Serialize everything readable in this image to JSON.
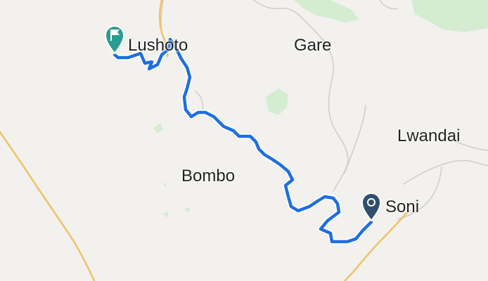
{
  "map": {
    "colors": {
      "background": "#f2f1ee",
      "green_area": "#d4ecd0",
      "major_road": "#f0c36a",
      "minor_road": "#cfcfcf",
      "route": "#1e6fe0",
      "route_outline": "#ffffff",
      "start_marker": "#2a9d8f",
      "end_marker": "#2f4f6f"
    },
    "places": {
      "lushoto": "Lushoto",
      "gare": "Gare",
      "lwandai": "Lwandai",
      "bombo": "Bombo",
      "soni": "Soni"
    },
    "markers": {
      "start_icon": "flag-pin-icon",
      "end_icon": "map-pin-icon"
    }
  }
}
